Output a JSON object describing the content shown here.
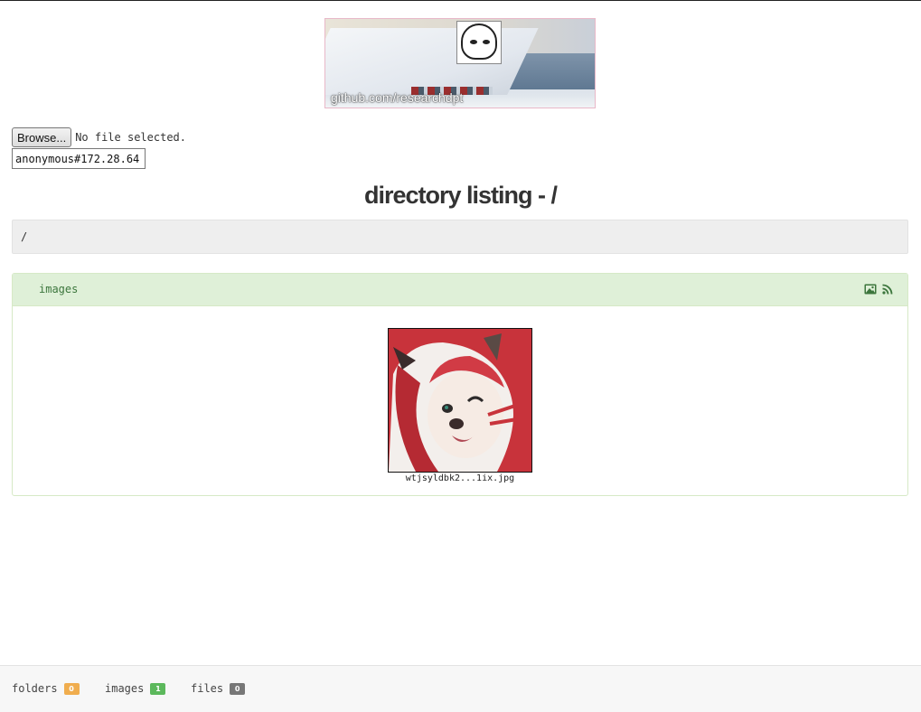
{
  "banner": {
    "caption": "github.com/researchdpt"
  },
  "upload": {
    "browse_label": "Browse...",
    "no_file_text": "No file selected.",
    "user_value": "anonymous#172.28.64."
  },
  "page": {
    "title": "directory listing - /"
  },
  "breadcrumb": {
    "path": "/"
  },
  "images_panel": {
    "title": "images",
    "icons": [
      "image-icon",
      "rss-icon"
    ],
    "files": [
      {
        "name": "wtjsyldbk2...1ix.jpg"
      }
    ]
  },
  "footer": {
    "stats": [
      {
        "label": "folders",
        "count": "0",
        "color": "#f0ad4e"
      },
      {
        "label": "images",
        "count": "1",
        "color": "#5cb85c"
      },
      {
        "label": "files",
        "count": "0",
        "color": "#777777"
      }
    ]
  },
  "colors": {
    "panel_header_bg": "#dff0d8",
    "panel_header_text": "#3c763d",
    "breadcrumb_bg": "#eeeeee"
  }
}
